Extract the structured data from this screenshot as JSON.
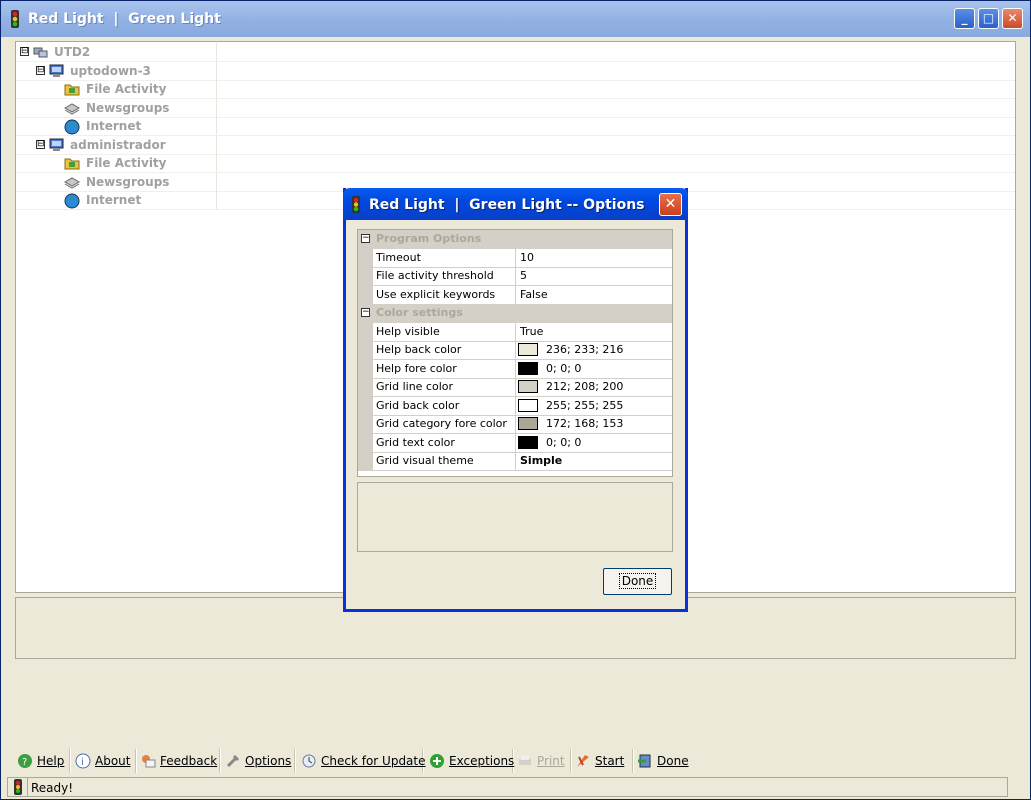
{
  "window": {
    "title": "Red Light  |  Green Light"
  },
  "tree": {
    "items": [
      {
        "label": "UTD2",
        "level": 0,
        "icon": "network-icon",
        "expander": "⊟"
      },
      {
        "label": "uptodown-3",
        "level": 1,
        "icon": "computer-icon",
        "expander": "⊟"
      },
      {
        "label": "File Activity",
        "level": 2,
        "icon": "folder-icon"
      },
      {
        "label": "Newsgroups",
        "level": 2,
        "icon": "newsgroups-icon"
      },
      {
        "label": "Internet",
        "level": 2,
        "icon": "globe-icon"
      },
      {
        "label": "administrador",
        "level": 1,
        "icon": "computer-icon",
        "expander": "⊟"
      },
      {
        "label": "File Activity",
        "level": 2,
        "icon": "folder-icon"
      },
      {
        "label": "Newsgroups",
        "level": 2,
        "icon": "newsgroups-icon"
      },
      {
        "label": "Internet",
        "level": 2,
        "icon": "globe-icon"
      }
    ]
  },
  "dialog": {
    "title": "Red Light  |  Green Light -- Options",
    "close_glyph": "✕",
    "categories": [
      {
        "label": "Program Options"
      },
      {
        "label": "Color settings"
      }
    ],
    "properties": [
      {
        "name": "Timeout",
        "value": "10"
      },
      {
        "name": "File activity threshold",
        "value": "5"
      },
      {
        "name": "Use explicit keywords",
        "value": "False"
      },
      {
        "name": "Help visible",
        "value": "True"
      },
      {
        "name": "Help back color",
        "value": "236; 233; 216",
        "swatch": "#ece9d8"
      },
      {
        "name": "Help fore color",
        "value": "0; 0; 0",
        "swatch": "#000000"
      },
      {
        "name": "Grid line color",
        "value": "212; 208; 200",
        "swatch": "#d4d0c8"
      },
      {
        "name": "Grid back color",
        "value": "255; 255; 255",
        "swatch": "#ffffff"
      },
      {
        "name": "Grid category fore color",
        "value": "172; 168; 153",
        "swatch": "#aca899"
      },
      {
        "name": "Grid text color",
        "value": "0; 0; 0",
        "swatch": "#000000"
      },
      {
        "name": "Grid visual theme",
        "value": "Simple"
      }
    ],
    "done_label": "Done"
  },
  "toolbar": {
    "items": [
      {
        "label": "Help",
        "icon": "help-icon"
      },
      {
        "label": "About",
        "icon": "about-icon"
      },
      {
        "label": "Feedback",
        "icon": "feedback-icon"
      },
      {
        "label": "Options",
        "icon": "options-icon"
      },
      {
        "label": "Check for Update",
        "icon": "update-icon"
      },
      {
        "label": "Exceptions",
        "icon": "exceptions-icon"
      },
      {
        "label": "Print",
        "icon": "print-icon",
        "disabled": true
      },
      {
        "label": "Start",
        "icon": "start-icon"
      },
      {
        "label": "Done",
        "icon": "done-icon"
      }
    ]
  },
  "status": {
    "text": "Ready!"
  },
  "colors": {
    "titlebar": "#93b2e4",
    "dialog_titlebar": "#0048e0",
    "window_bg": "#ece9d8"
  }
}
